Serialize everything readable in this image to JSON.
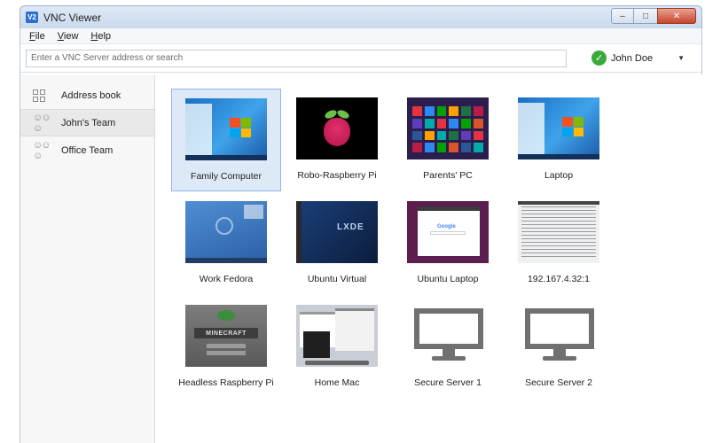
{
  "window": {
    "title": "VNC Viewer",
    "app_icon": "V2"
  },
  "menu": [
    "File",
    "View",
    "Help"
  ],
  "search": {
    "placeholder": "Enter a VNC Server address or search",
    "value": ""
  },
  "user": {
    "name": "John Doe",
    "status_color": "#3aaa3a"
  },
  "sidebar": {
    "items": [
      {
        "label": "Address book",
        "icon": "grid-icon"
      },
      {
        "label": "John's Team",
        "icon": "team-icon"
      },
      {
        "label": "Office Team",
        "icon": "team-icon"
      }
    ],
    "active": "John's Team"
  },
  "computers": [
    {
      "label": "Family Computer",
      "thumb": "windows-7-desktop",
      "selected": true
    },
    {
      "label": "Robo-Raspberry Pi",
      "thumb": "raspberry-pi-logo"
    },
    {
      "label": "Parents' PC",
      "thumb": "windows-8-start"
    },
    {
      "label": "Laptop",
      "thumb": "windows-7-desktop"
    },
    {
      "label": "Work Fedora",
      "thumb": "fedora-desktop"
    },
    {
      "label": "Ubuntu Virtual",
      "thumb": "ubuntu-desktop"
    },
    {
      "label": "Ubuntu Laptop",
      "thumb": "ubuntu-browser"
    },
    {
      "label": "192.167.4.32:1",
      "thumb": "terminal"
    },
    {
      "label": "Headless Raspberry Pi",
      "thumb": "minecraft"
    },
    {
      "label": "Home Mac",
      "thumb": "mac-desktop"
    },
    {
      "label": "Secure Server 1",
      "thumb": "generic-monitor"
    },
    {
      "label": "Secure Server 2",
      "thumb": "generic-monitor"
    }
  ],
  "colors": {
    "selection_bg": "#dde9f6",
    "selection_border": "#90b7e6",
    "close_button": "#c8442c"
  }
}
